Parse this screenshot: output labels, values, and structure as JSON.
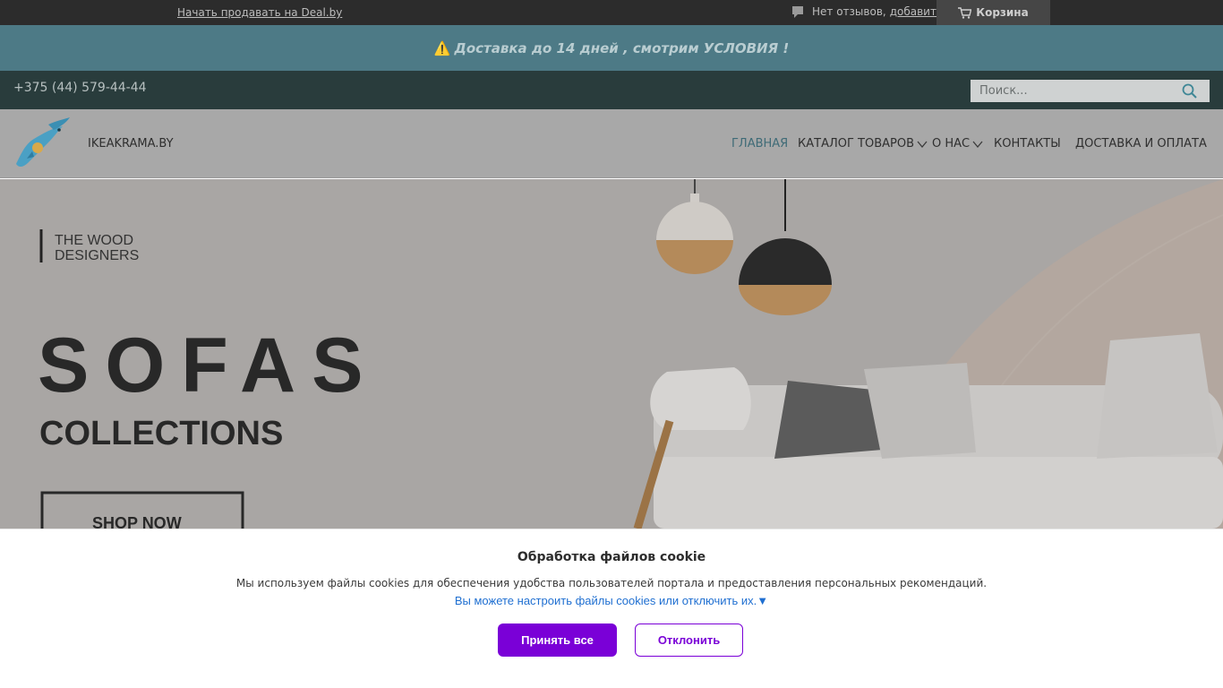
{
  "topbar": {
    "sell_link": "Начать продавать на Deal.by",
    "reviews_text": "Нет отзывов,",
    "reviews_add": "добавить",
    "cart_label": "Корзина"
  },
  "promo": {
    "icon": "warning-icon",
    "text": "Доставка до 14 дней , смотрим УСЛОВИЯ !"
  },
  "contact": {
    "phone": "+375 (44) 579-44-44"
  },
  "search": {
    "placeholder": "Поиск..."
  },
  "nav": {
    "brand": "IKEAKRAMA.BY",
    "items": [
      {
        "label": "ГЛАВНАЯ",
        "active": true
      },
      {
        "label": "КАТАЛОГ ТОВАРОВ",
        "dropdown": true
      },
      {
        "label": "О НАС",
        "dropdown": true
      },
      {
        "label": "КОНТАКТЫ"
      },
      {
        "label": "ДОСТАВКА И ОПЛАТА"
      }
    ]
  },
  "hero": {
    "brand_line1": "THE WOOD",
    "brand_line2": "DESIGNERS",
    "headline": "SOFAS",
    "subheadline": "COLLECTIONS",
    "cta": "SHOP NOW"
  },
  "cookie": {
    "title": "Обработка файлов cookie",
    "text": "Мы используем файлы cookies для обеспечения удобства пользователей портала и предоставления персональных рекомендаций.",
    "settings_link": "Вы можете настроить файлы cookies или отключить их.▼",
    "accept": "Принять все",
    "decline": "Отклонить"
  },
  "colors": {
    "accent": "#7a00d7",
    "promo_bg": "#4d7a86",
    "active_nav": "#3f6b77",
    "link": "#1f6fd1"
  }
}
